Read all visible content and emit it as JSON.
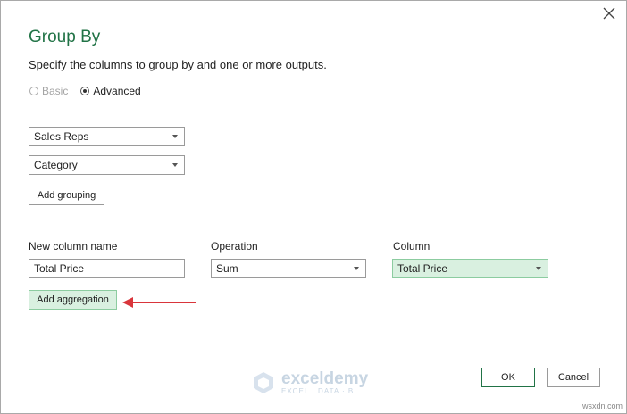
{
  "dialog": {
    "title": "Group By",
    "subtitle": "Specify the columns to group by and one or more outputs.",
    "close_icon": "close-icon"
  },
  "mode": {
    "basic_label": "Basic",
    "advanced_label": "Advanced",
    "selected": "Advanced"
  },
  "grouping": {
    "items": [
      "Sales Reps",
      "Category"
    ],
    "add_label": "Add grouping"
  },
  "aggregation": {
    "headers": {
      "new_column_name": "New column name",
      "operation": "Operation",
      "column": "Column"
    },
    "row": {
      "name": "Total Price",
      "operation": "Sum",
      "column": "Total Price"
    },
    "add_label": "Add aggregation"
  },
  "footer": {
    "ok_label": "OK",
    "cancel_label": "Cancel"
  },
  "watermark": {
    "name": "exceldemy",
    "tagline": "EXCEL · DATA · BI"
  },
  "site_mark": "wsxdn.com",
  "colors": {
    "accent": "#217346",
    "highlight": "#d9f0e0",
    "annotation_arrow": "#d9353b"
  }
}
